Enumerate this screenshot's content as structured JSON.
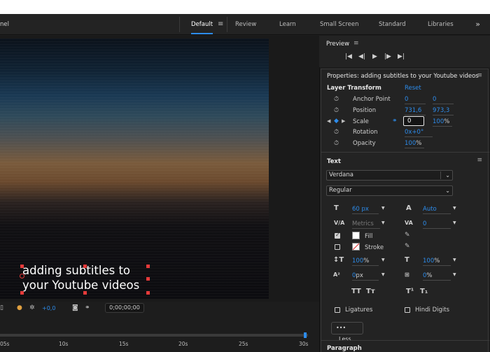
{
  "header": {
    "panel_name": "nel",
    "workspaces": [
      "Default",
      "Review",
      "Learn",
      "Small Screen",
      "Standard",
      "Libraries"
    ],
    "active_workspace": "Default",
    "more": "»"
  },
  "program": {
    "subtitle_line1": "adding subtitles to",
    "subtitle_line2": "your Youtube videos",
    "offset_value": "+0,0",
    "timecode": "0;00;00;00"
  },
  "timeline": {
    "ticks": [
      "05s",
      "10s",
      "15s",
      "20s",
      "25s",
      "30s"
    ]
  },
  "preview": {
    "title": "Preview",
    "menu": "≡"
  },
  "properties": {
    "title": "Properties: adding subtitles to your Youtube videos",
    "layer_transform": {
      "heading": "Layer Transform",
      "reset": "Reset",
      "anchor_label": "Anchor Point",
      "anchor_x": "0",
      "anchor_y": "0",
      "position_label": "Position",
      "position_x": "731,6",
      "position_y": "973,3",
      "scale_label": "Scale",
      "scale_value": "0",
      "scale_percent": "100",
      "pct": "%",
      "rotation_label": "Rotation",
      "rotation_value": "0x+0°",
      "opacity_label": "Opacity",
      "opacity_value": "100"
    },
    "text": {
      "heading": "Text",
      "font": "Verdana",
      "style": "Regular",
      "size": "60",
      "size_unit": "px",
      "leading": "Auto",
      "kerning": "Metrics",
      "tracking": "0",
      "fill_label": "Fill",
      "stroke_label": "Stroke",
      "vscale": "100",
      "hscale": "100",
      "baseline": "0",
      "baseline_unit": "px",
      "tsume": "0",
      "ligatures_label": "Ligatures",
      "hindi_label": "Hindi Digits",
      "less_label": "Less"
    },
    "paragraph": {
      "heading": "Paragraph"
    }
  }
}
